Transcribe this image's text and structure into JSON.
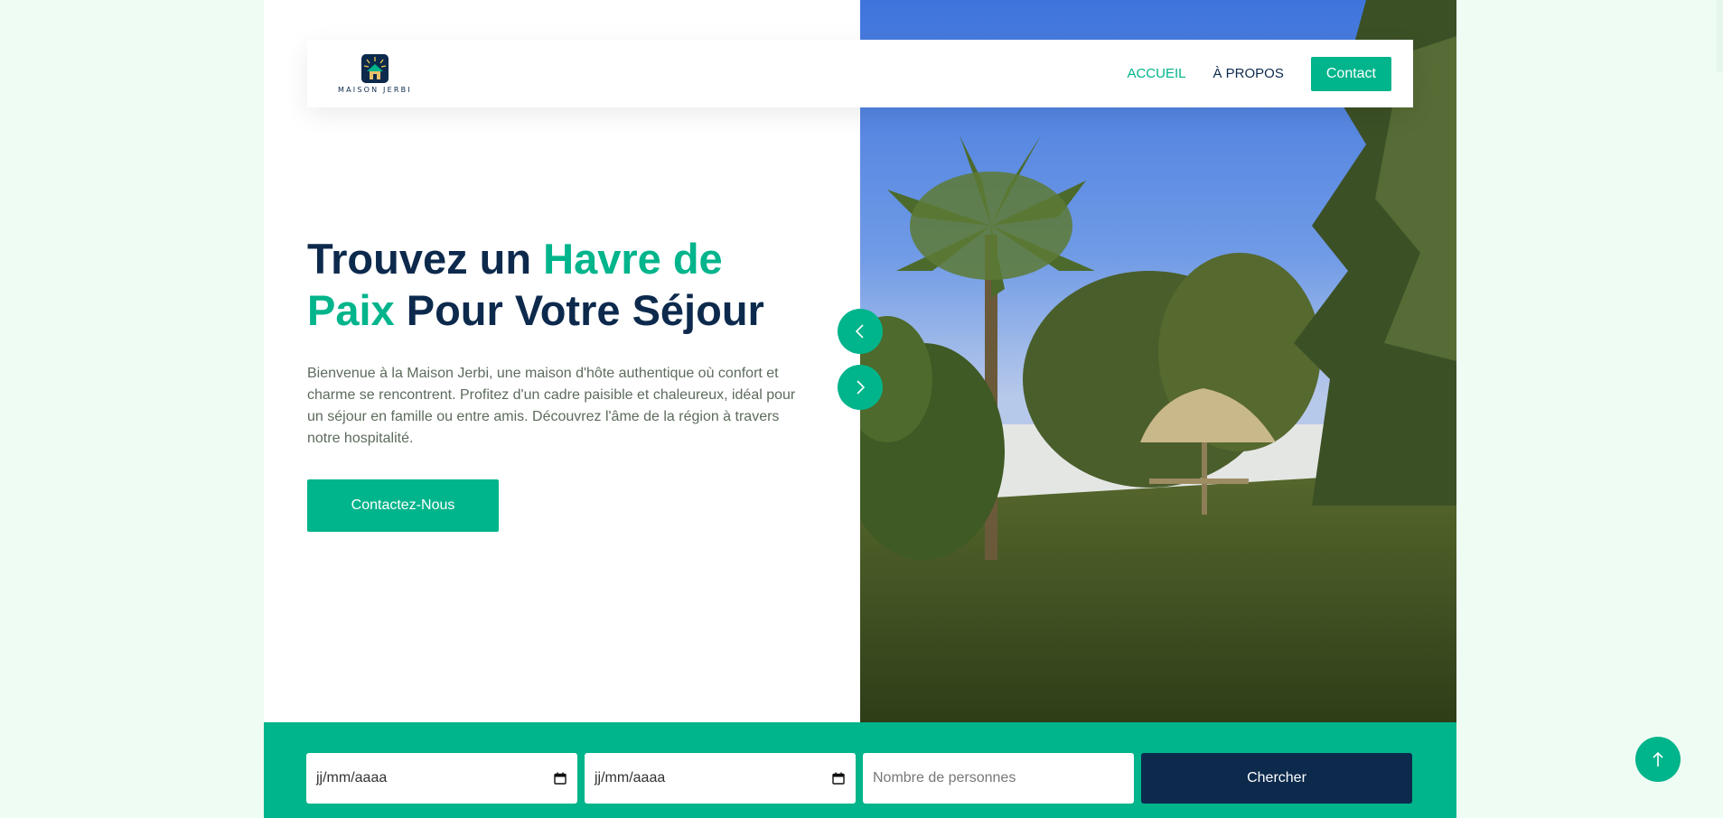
{
  "brand": {
    "name": "MAISON JERBI",
    "logo_icon": "house-sun-logo-icon"
  },
  "nav": {
    "items": [
      {
        "label": "ACCUEIL",
        "active": true
      },
      {
        "label": "À PROPOS",
        "active": false
      }
    ],
    "contact_label": "Contact"
  },
  "hero": {
    "title_part1": "Trouvez un ",
    "title_accent1": "Havre de",
    "title_accent2": "Paix",
    "title_part2": " Pour Votre Séjour",
    "description": "Bienvenue à la Maison Jerbi, une maison d'hôte authentique où confort et charme se rencontrent. Profitez d'un cadre paisible et chaleureux, idéal pour un séjour en famille ou entre amis. Découvrez l'âme de la région à travers notre hospitalité.",
    "cta_label": "Contactez-Nous",
    "image_alt": "garden-with-palm-trees-and-thatched-umbrella"
  },
  "carousel": {
    "prev_icon": "chevron-left-icon",
    "next_icon": "chevron-right-icon"
  },
  "search": {
    "checkin_placeholder": "jj/mm/aaaa",
    "checkout_placeholder": "jj/mm/aaaa",
    "persons_placeholder": "Nombre de personnes",
    "button_label": "Chercher",
    "calendar_icon": "calendar-icon"
  },
  "back_to_top_icon": "arrow-up-icon",
  "colors": {
    "accent": "#00b48b",
    "navy": "#0d2a4d",
    "page_bg": "#effcf3"
  }
}
